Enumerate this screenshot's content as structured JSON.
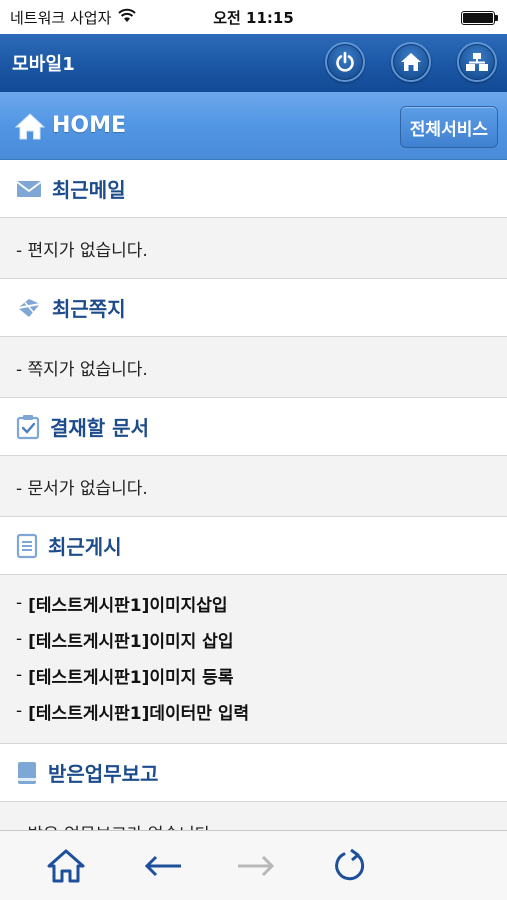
{
  "status_bar": {
    "carrier": "네트워크 사업자",
    "time": "오전 11:15"
  },
  "app_header": {
    "title": "모바일1",
    "buttons": [
      "power-icon",
      "home-icon",
      "sitemap-icon"
    ]
  },
  "sub_bar": {
    "home_label": "HOME",
    "all_services_label": "전체서비스"
  },
  "sections": {
    "mail": {
      "title": "최근메일",
      "icon": "mail-icon",
      "empty": "- 편지가 없습니다."
    },
    "notes": {
      "title": "최근쪽지",
      "icon": "note-icon",
      "empty": "- 쪽지가 없습니다."
    },
    "approval": {
      "title": "결재할 문서",
      "icon": "clipboard-check-icon",
      "empty": "- 문서가 없습니다."
    },
    "posts": {
      "title": "최근게시",
      "icon": "document-icon",
      "dash": "-",
      "items": [
        "[테스트게시판1]이미지삽입",
        "[테스트게시판1]이미지 삽입",
        "[테스트게시판1]이미지 등록",
        "[테스트게시판1]데이터만 입력"
      ]
    },
    "reports": {
      "title": "받은업무보고",
      "icon": "book-icon",
      "empty": "- 받은 업무보고가 없습니다."
    }
  },
  "toolbar": {
    "buttons": [
      "home-icon",
      "back-arrow-icon",
      "forward-arrow-icon",
      "refresh-icon"
    ]
  },
  "colors": {
    "header": "#1d5aa8",
    "sub_bar": "#5196e4",
    "section_title": "#1d4c8c",
    "toolbar_icon": "#1e4f9a",
    "disabled_icon": "#b8b8b8"
  }
}
